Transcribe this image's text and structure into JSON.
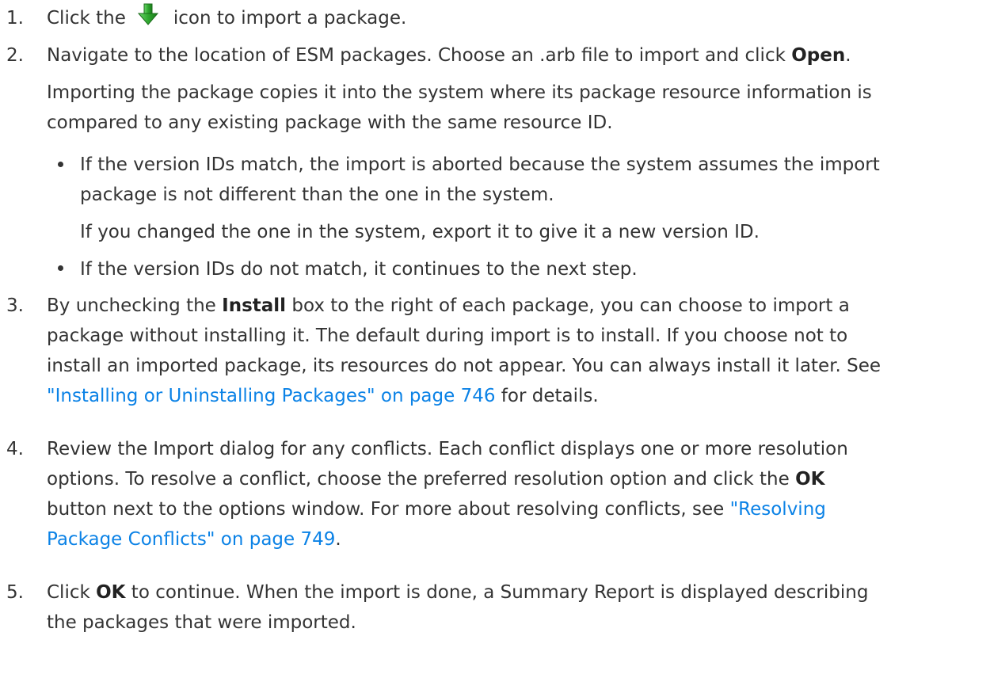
{
  "steps": [
    {
      "number": "1.",
      "text_before_icon": "Click the",
      "icon": "green-down-arrow-icon",
      "text_after_icon": "icon to import a package."
    },
    {
      "number": "2.",
      "text_before_bold": "Navigate to the location of ESM packages. Choose an .arb file to import and click ",
      "bold": "Open",
      "text_after_bold": ".",
      "paragraph_line1": "Importing the package copies it into the system where its package resource information is",
      "paragraph_line2": "compared to any existing package with the same resource ID.",
      "bullets": [
        {
          "line1": "If the version IDs match, the import is aborted because the system assumes the import",
          "line2": "package is not different than the one in the system.",
          "note": "If you changed the one in the system, export it to give it a new version ID."
        },
        {
          "line1": "If the version IDs do not match, it continues to the next step."
        }
      ]
    },
    {
      "number": "3.",
      "line1_before_bold": "By unchecking the ",
      "line1_bold": "Install",
      "line1_after_bold": " box to the right of each package, you can choose to import a",
      "line2": "package without installing it. The default during import is to install. If you choose not to",
      "line3": "install an imported package, its resources do not appear. You can always install it later. See",
      "link": "\"Installing or Uninstalling Packages\" on page 746",
      "line4_after_link": " for details."
    },
    {
      "number": "4.",
      "line1": "Review the Import dialog for any conflicts. Each conflict displays one or more resolution",
      "line2_before_bold": "options. To resolve a conflict, choose the preferred resolution option and click the ",
      "line2_bold": "OK",
      "line3_before_link": "button next to the options window. For more about resolving conflicts, see ",
      "link_part1": "\"Resolving",
      "link_part2": "Package Conflicts\" on page 749",
      "line4_after_link": "."
    },
    {
      "number": "5.",
      "line1_before_bold": "Click ",
      "line1_bold": "OK",
      "line1_after_bold": " to continue. When the import is done, a Summary Report is displayed describing",
      "line2": "the packages that were imported."
    }
  ],
  "colors": {
    "text": "#333333",
    "link": "#0b82e6",
    "icon_green": "#2fa82f"
  }
}
